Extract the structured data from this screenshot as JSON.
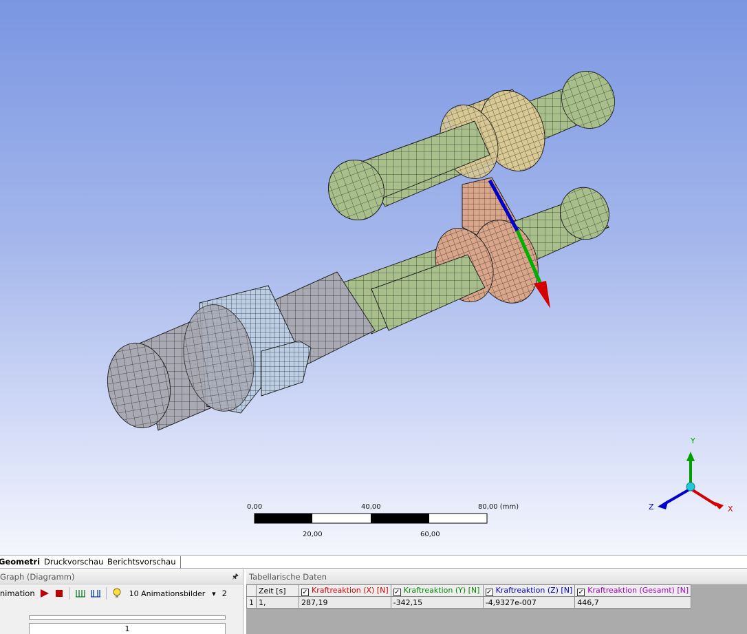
{
  "viewport": {
    "scale_bar": {
      "top_labels": [
        "0,00",
        "40,00",
        "80,00 (mm)"
      ],
      "bottom_labels": [
        "20,00",
        "60,00"
      ]
    },
    "axis_triad": {
      "y": "Y",
      "z": "Z",
      "x": "X"
    },
    "colors": {
      "background_top": "#7a96e2",
      "shaft_green": "#a8bf8c",
      "shaft_gray": "#a9a9b4",
      "bearing_yellow": "#d9c995",
      "connector_salmon": "#d9a68b",
      "ring_lightblue": "#bccde4",
      "axis_x": "#d40000",
      "axis_y": "#00a000",
      "axis_z": "#0000c8"
    }
  },
  "view_tabs": {
    "items": [
      "Geometrie",
      "Druckvorschau",
      "Berichtsvorschau"
    ],
    "active": "Geometrie"
  },
  "graph_panel": {
    "title": "Graph (Diagramm)",
    "animation_label": "Animation",
    "frames_option": "10 Animationsbilder",
    "frames_extra": "2",
    "timeline_value": "1"
  },
  "table_panel": {
    "title": "Tabellarische Daten",
    "columns": [
      {
        "label": "Zeit [s]",
        "checkbox": false,
        "color": "#000000"
      },
      {
        "label": "Kraftreaktion (X) [N]",
        "checkbox": true,
        "color": "#d40000"
      },
      {
        "label": "Kraftreaktion (Y) [N]",
        "checkbox": true,
        "color": "#008a00"
      },
      {
        "label": "Kraftreaktion (Z) [N]",
        "checkbox": true,
        "color": "#0000c0"
      },
      {
        "label": "Kraftreaktion (Gesamt) [N]",
        "checkbox": true,
        "color": "#a000c0"
      }
    ],
    "rows": [
      {
        "index": "1",
        "cells": [
          "1,",
          "287,19",
          "-342,15",
          "-4,9327e-007",
          "446,7"
        ]
      }
    ]
  }
}
